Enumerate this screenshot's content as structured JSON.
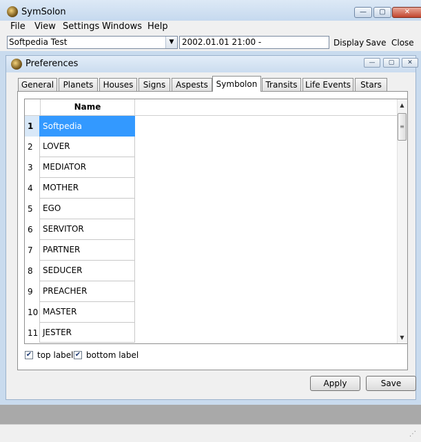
{
  "app": {
    "title": "SymSolon"
  },
  "window_buttons": {
    "minimize": "—",
    "maximize": "▢",
    "close": "✕"
  },
  "menu": [
    "File",
    "View",
    "Settings",
    "Windows",
    "Help"
  ],
  "toolbar": {
    "chart_selector": "Softpedia Test",
    "date_value": "2002.01.01 21:00 -",
    "display_label": "Display",
    "save_label": "Save",
    "close_label": "Close"
  },
  "preferences": {
    "title": "Preferences",
    "tabs": [
      "General",
      "Planets",
      "Houses",
      "Signs",
      "Aspests",
      "Symbolon",
      "Transits",
      "Life Events",
      "Stars"
    ],
    "active_tab": "Symbolon",
    "grid": {
      "column_header": "Name",
      "rows": [
        {
          "num": "1",
          "name": "Softpedia"
        },
        {
          "num": "2",
          "name": "LOVER"
        },
        {
          "num": "3",
          "name": "MEDIATOR"
        },
        {
          "num": "4",
          "name": "MOTHER"
        },
        {
          "num": "5",
          "name": "EGO"
        },
        {
          "num": "6",
          "name": "SERVITOR"
        },
        {
          "num": "7",
          "name": "PARTNER"
        },
        {
          "num": "8",
          "name": "SEDUCER"
        },
        {
          "num": "9",
          "name": "PREACHER"
        },
        {
          "num": "10",
          "name": "MASTER"
        },
        {
          "num": "11",
          "name": "JESTER"
        }
      ],
      "selected_row": "1"
    },
    "checkboxes": [
      {
        "label": "top label",
        "checked": true
      },
      {
        "label": "bottom label",
        "checked": true
      }
    ],
    "apply_label": "Apply",
    "save_label": "Save"
  },
  "colors": {
    "selection": "#3399ff",
    "titlebar": "#c4d8ee",
    "background": "#f0f0f0"
  }
}
